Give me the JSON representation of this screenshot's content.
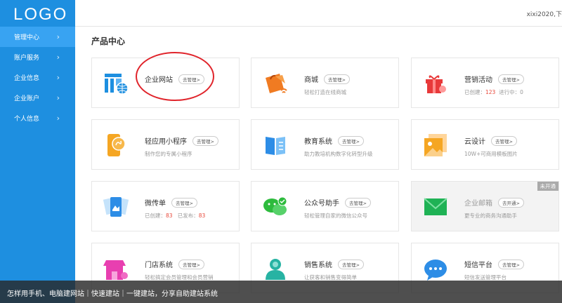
{
  "logo": "LOGO",
  "user": "xixi2020,下",
  "nav": [
    {
      "label": "管理中心",
      "active": true
    },
    {
      "label": "账户服务",
      "active": false
    },
    {
      "label": "企业信息",
      "active": false
    },
    {
      "label": "企业账户",
      "active": false
    },
    {
      "label": "个人信息",
      "active": false
    }
  ],
  "chevron": "›",
  "page_title": "产品中心",
  "cards": [
    {
      "name": "企业网站",
      "btn": "去管理>",
      "icon": "website-icon"
    },
    {
      "name": "商城",
      "btn": "去管理>",
      "desc": "轻松打造在线商城",
      "icon": "shop-bag-icon"
    },
    {
      "name": "营销活动",
      "btn": "去管理>",
      "desc_a": "已创建：",
      "num_a": "123",
      "desc_b": "进行中：0",
      "icon": "gift-icon"
    },
    {
      "name": "轻应用小程序",
      "btn": "去管理>",
      "desc": "制作您的专属小程序",
      "icon": "mini-program-icon"
    },
    {
      "name": "教育系统",
      "btn": "去管理>",
      "desc": "助力教培机构数字化转型升级",
      "icon": "book-icon"
    },
    {
      "name": "云设计",
      "btn": "去管理>",
      "desc": "10W+可商用模板图片",
      "icon": "image-template-icon"
    },
    {
      "name": "微传单",
      "btn": "去管理>",
      "desc_a": "已创建：",
      "num_a": "83",
      "desc_b": "已发布：",
      "num_b": "83",
      "icon": "flyer-icon"
    },
    {
      "name": "公众号助手",
      "btn": "去管理>",
      "desc": "轻松管理自家的微信公众号",
      "icon": "wechat-icon"
    },
    {
      "name": "企业邮箱",
      "btn": "去开通>",
      "desc": "更专业的商务沟通助手",
      "badge": "未开通",
      "icon": "mail-icon"
    },
    {
      "name": "门店系统",
      "btn": "去管理>",
      "desc": "轻松搞定会员管理和会员营销",
      "icon": "store-icon"
    },
    {
      "name": "销售系统",
      "btn": "去管理>",
      "desc": "让获客和销售变得简单",
      "icon": "sales-person-icon"
    },
    {
      "name": "短信平台",
      "btn": "去管理>",
      "desc": "短信发送管理平台",
      "icon": "sms-icon"
    }
  ],
  "caption": "怎样用手机、电脑建网站｜快速建站｜一键建站，分享自助建站系统"
}
